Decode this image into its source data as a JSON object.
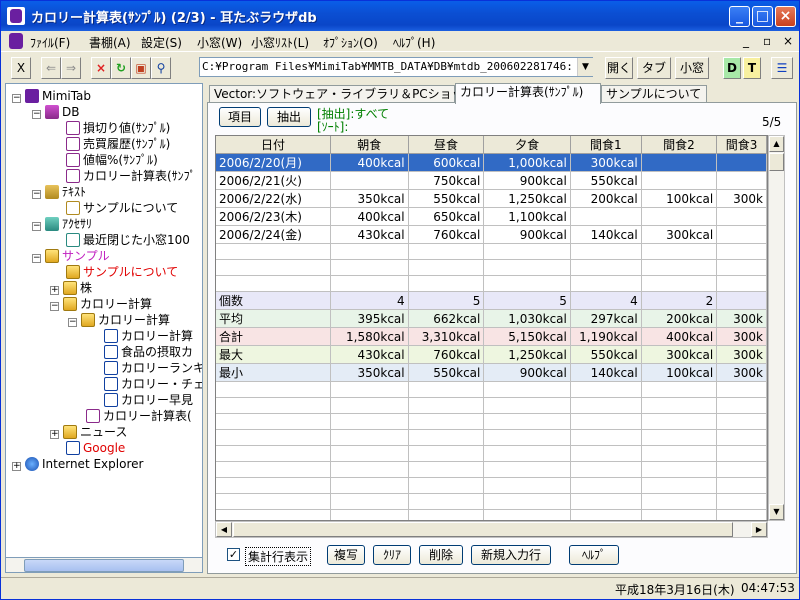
{
  "window": {
    "title": "カロリー計算表(ｻﾝﾌﾟﾙ) (2/3) - 耳たぶラウザdb"
  },
  "menu": [
    "ﾌｧｲﾙ(F)",
    "書棚(A)",
    "設定(S)",
    "小窓(W)",
    "小窓ﾘｽﾄ(L)",
    "ｵﾌﾟｼｮﾝ(O)",
    "ﾍﾙﾌﾟ(H)"
  ],
  "mdi_buttons": [
    "_",
    "▫",
    "×"
  ],
  "toolbar": {
    "close_x": "X",
    "back": "⇐",
    "forward": "⇒",
    "address": "C:¥Program Files¥MimiTab¥MMTB_DATA¥DB¥mtdb_200602281746:",
    "open": "開く",
    "tab": "タブ",
    "small_window": "小窓",
    "d": "D",
    "t": "T"
  },
  "tree": {
    "root": "MimiTab",
    "db": "DB",
    "db_items": [
      "損切り値(ｻﾝﾌﾟﾙ)",
      "売買履歴(ｻﾝﾌﾟﾙ)",
      "値幅%(ｻﾝﾌﾟﾙ)",
      "カロリー計算表(ｻﾝﾌﾟ"
    ],
    "text": "ﾃｷｽﾄ",
    "text_items": [
      "サンプルについて"
    ],
    "accessory": "ｱｸｾｻﾘ",
    "accessory_items": [
      "最近閉じた小窓100"
    ],
    "sample": "サンプル",
    "sample_about": "サンプルについて",
    "stock": "株",
    "calorie": "カロリー計算",
    "calorie_sub": "カロリー計算",
    "calorie_items": [
      "カロリー計算",
      "食品の摂取カ",
      "カロリーランキ",
      "カロリー・チェ",
      "カロリー早見"
    ],
    "calorie_table": "カロリー計算表(",
    "news": "ニュース",
    "google": "Google",
    "ie": "Internet Explorer"
  },
  "tabs": [
    "Vector:ソフトウェア・ライブラリ＆PCショップ",
    "カロリー計算表(ｻﾝﾌﾟﾙ)",
    "サンプルについて"
  ],
  "content": {
    "item_button": "項目",
    "extract_button": "抽出",
    "extract_label": "[抽出]:すべて",
    "sort_label": "[ｿｰﾄ]:",
    "page_count": "5/5"
  },
  "grid": {
    "headers": [
      "日付",
      "朝食",
      "昼食",
      "夕食",
      "間食1",
      "間食2",
      "間食3"
    ],
    "rows": [
      [
        "2006/2/20(月)",
        "400kcal",
        "600kcal",
        "1,000kcal",
        "300kcal",
        "",
        ""
      ],
      [
        "2006/2/21(火)",
        "",
        "750kcal",
        "900kcal",
        "550kcal",
        "",
        ""
      ],
      [
        "2006/2/22(水)",
        "350kcal",
        "550kcal",
        "1,250kcal",
        "200kcal",
        "100kcal",
        "300k"
      ],
      [
        "2006/2/23(木)",
        "400kcal",
        "650kcal",
        "1,100kcal",
        "",
        "",
        ""
      ],
      [
        "2006/2/24(金)",
        "430kcal",
        "760kcal",
        "900kcal",
        "140kcal",
        "300kcal",
        ""
      ]
    ],
    "summary": [
      [
        "個数",
        "4",
        "5",
        "5",
        "4",
        "2",
        ""
      ],
      [
        "平均",
        "395kcal",
        "662kcal",
        "1,030kcal",
        "297kcal",
        "200kcal",
        "300k"
      ],
      [
        "合計",
        "1,580kcal",
        "3,310kcal",
        "5,150kcal",
        "1,190kcal",
        "400kcal",
        "300k"
      ],
      [
        "最大",
        "430kcal",
        "760kcal",
        "1,250kcal",
        "550kcal",
        "300kcal",
        "300k"
      ],
      [
        "最小",
        "350kcal",
        "550kcal",
        "900kcal",
        "140kcal",
        "100kcal",
        "300k"
      ]
    ]
  },
  "bottom": {
    "show_summary": "集計行表示",
    "copy": "複写",
    "clear": "ｸﾘｱ",
    "delete": "削除",
    "new_row": "新規入力行",
    "help": "ﾍﾙﾌﾟ"
  },
  "status": {
    "date": "平成18年3月16日(木)",
    "time": "04:47:53"
  }
}
